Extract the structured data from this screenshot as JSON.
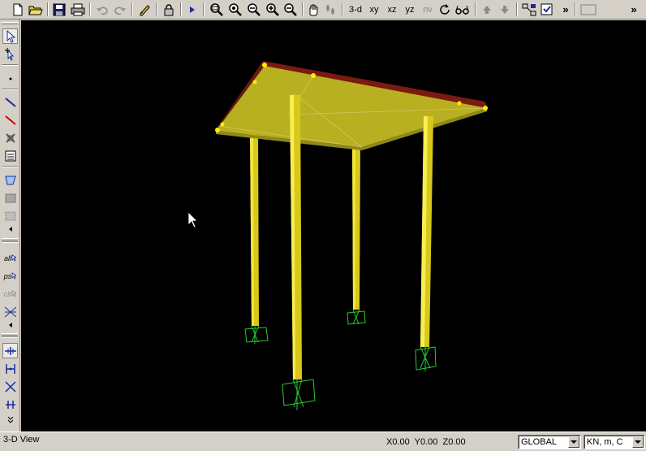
{
  "toolbar": {
    "view_buttons": [
      "3-d",
      "xy",
      "xz",
      "yz",
      "nv"
    ],
    "overflow_glyph": "»"
  },
  "left_toolbar": {
    "all_label": "all",
    "ps_label": "ps",
    "clr_label": "clr"
  },
  "viewport": {
    "background": "#000000",
    "slab_color": "#b5ae1e",
    "slab_edge_color": "#7a1a10",
    "column_color": "#e8d81a",
    "support_color": "#22cc33",
    "joint_color": "#ffee00"
  },
  "status": {
    "window_title": "3-D View",
    "coords": "X0.00  Y0.00  Z0.00",
    "coord_system": "GLOBAL",
    "units": "KN, m, C"
  }
}
